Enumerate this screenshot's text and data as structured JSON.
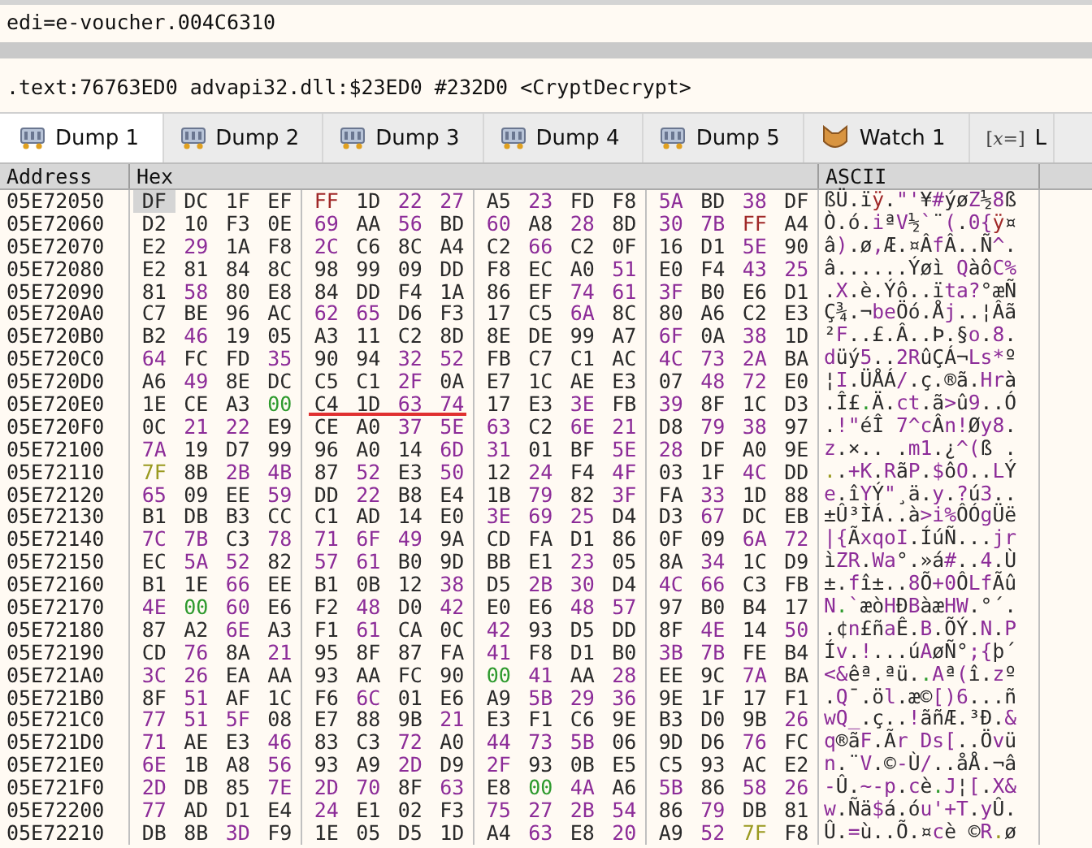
{
  "info": {
    "register_line": "edi=e-voucher.004C6310",
    "symbol_line": ".text:76763ED0 advapi32.dll:$23ED0 #232D0 <CryptDecrypt>"
  },
  "tabs": [
    {
      "label": "Dump 1",
      "kind": "dump",
      "selected": true
    },
    {
      "label": "Dump 2",
      "kind": "dump",
      "selected": false
    },
    {
      "label": "Dump 3",
      "kind": "dump",
      "selected": false
    },
    {
      "label": "Dump 4",
      "kind": "dump",
      "selected": false
    },
    {
      "label": "Dump 5",
      "kind": "dump",
      "selected": false
    },
    {
      "label": "Watch 1",
      "kind": "watch",
      "selected": false
    },
    {
      "label": "L",
      "kind": "locals",
      "glyph": "[*x=*]",
      "selected": false
    }
  ],
  "dump": {
    "columns": [
      "Address",
      "Hex",
      "ASCII"
    ],
    "rows": [
      {
        "address": "05E72050",
        "bytes": [
          "DF",
          "DC",
          "1F",
          "EF",
          "FF",
          "1D",
          "22",
          "27",
          "A5",
          "23",
          "FD",
          "F8",
          "5A",
          "BD",
          "38",
          "DF"
        ],
        "ascii": "ßÜ.ïÿ.\"'¥#ýøZ½8ß",
        "cursor": true,
        "underlined": false
      },
      {
        "address": "05E72060",
        "bytes": [
          "D2",
          "10",
          "F3",
          "0E",
          "69",
          "AA",
          "56",
          "BD",
          "60",
          "A8",
          "28",
          "8D",
          "30",
          "7B",
          "FF",
          "A4"
        ],
        "ascii": "Ò.ó.iªV½`¨(.0{ÿ¤",
        "cursor": false,
        "underlined": false
      },
      {
        "address": "05E72070",
        "bytes": [
          "E2",
          "29",
          "1A",
          "F8",
          "2C",
          "C6",
          "8C",
          "A4",
          "C2",
          "66",
          "C2",
          "0F",
          "16",
          "D1",
          "5E",
          "90"
        ],
        "ascii": "â).ø,Æ.¤ÂfÂ..Ñ^.",
        "cursor": false,
        "underlined": false
      },
      {
        "address": "05E72080",
        "bytes": [
          "E2",
          "81",
          "84",
          "8C",
          "98",
          "99",
          "09",
          "DD",
          "F8",
          "EC",
          "A0",
          "51",
          "E0",
          "F4",
          "43",
          "25"
        ],
        "ascii": "â......Ýøì QàôC%",
        "cursor": false,
        "underlined": false
      },
      {
        "address": "05E72090",
        "bytes": [
          "81",
          "58",
          "80",
          "E8",
          "84",
          "DD",
          "F4",
          "1A",
          "86",
          "EF",
          "74",
          "61",
          "3F",
          "B0",
          "E6",
          "D1"
        ],
        "ascii": ".X.è.Ýô..ïta?°æÑ",
        "cursor": false,
        "underlined": false
      },
      {
        "address": "05E720A0",
        "bytes": [
          "C7",
          "BE",
          "96",
          "AC",
          "62",
          "65",
          "D6",
          "F3",
          "17",
          "C5",
          "6A",
          "8C",
          "80",
          "A6",
          "C2",
          "E3"
        ],
        "ascii": "Ç¾.¬beÖó.Åj..¦Âã",
        "cursor": false,
        "underlined": false
      },
      {
        "address": "05E720B0",
        "bytes": [
          "B2",
          "46",
          "19",
          "05",
          "A3",
          "11",
          "C2",
          "8D",
          "8E",
          "DE",
          "99",
          "A7",
          "6F",
          "0A",
          "38",
          "1D"
        ],
        "ascii": "²F..£.Â..Þ.§o.8.",
        "cursor": false,
        "underlined": false
      },
      {
        "address": "05E720C0",
        "bytes": [
          "64",
          "FC",
          "FD",
          "35",
          "90",
          "94",
          "32",
          "52",
          "FB",
          "C7",
          "C1",
          "AC",
          "4C",
          "73",
          "2A",
          "BA"
        ],
        "ascii": "düý5..2RûÇÁ¬Ls*º",
        "cursor": false,
        "underlined": false
      },
      {
        "address": "05E720D0",
        "bytes": [
          "A6",
          "49",
          "8E",
          "DC",
          "C5",
          "C1",
          "2F",
          "0A",
          "E7",
          "1C",
          "AE",
          "E3",
          "07",
          "48",
          "72",
          "E0"
        ],
        "ascii": "¦I.ÜÅÁ/.ç.®ã.Hrà",
        "cursor": false,
        "underlined": false
      },
      {
        "address": "05E720E0",
        "bytes": [
          "1E",
          "CE",
          "A3",
          "00",
          "C4",
          "1D",
          "63",
          "74",
          "17",
          "E3",
          "3E",
          "FB",
          "39",
          "8F",
          "1C",
          "D3"
        ],
        "ascii": ".Î£.Ä.ct.ã>û9..Ó",
        "cursor": false,
        "underlined": true
      },
      {
        "address": "05E720F0",
        "bytes": [
          "0C",
          "21",
          "22",
          "E9",
          "CE",
          "A0",
          "37",
          "5E",
          "63",
          "C2",
          "6E",
          "21",
          "D8",
          "79",
          "38",
          "97"
        ],
        "ascii": ".!\"éÎ 7^cÂn!Øy8.",
        "cursor": false,
        "underlined": false
      },
      {
        "address": "05E72100",
        "bytes": [
          "7A",
          "19",
          "D7",
          "99",
          "96",
          "A0",
          "14",
          "6D",
          "31",
          "01",
          "BF",
          "5E",
          "28",
          "DF",
          "A0",
          "9E"
        ],
        "ascii": "z.×.. .m1.¿^(ß .",
        "cursor": false,
        "underlined": false
      },
      {
        "address": "05E72110",
        "bytes": [
          "7F",
          "8B",
          "2B",
          "4B",
          "87",
          "52",
          "E3",
          "50",
          "12",
          "24",
          "F4",
          "4F",
          "03",
          "1F",
          "4C",
          "DD"
        ],
        "ascii": "..+K.RãP.$ôO..LÝ",
        "cursor": false,
        "underlined": false
      },
      {
        "address": "05E72120",
        "bytes": [
          "65",
          "09",
          "EE",
          "59",
          "DD",
          "22",
          "B8",
          "E4",
          "1B",
          "79",
          "82",
          "3F",
          "FA",
          "33",
          "1D",
          "88"
        ],
        "ascii": "e.îYÝ\"¸ä.y.?ú3..",
        "cursor": false,
        "underlined": false
      },
      {
        "address": "05E72130",
        "bytes": [
          "B1",
          "DB",
          "B3",
          "CC",
          "C1",
          "AD",
          "14",
          "E0",
          "3E",
          "69",
          "25",
          "D4",
          "D3",
          "67",
          "DC",
          "EB"
        ],
        "ascii": "±Û³ÌÁ..à>i%ÔÓgÜë",
        "cursor": false,
        "underlined": false
      },
      {
        "address": "05E72140",
        "bytes": [
          "7C",
          "7B",
          "C3",
          "78",
          "71",
          "6F",
          "49",
          "9A",
          "CD",
          "FA",
          "D1",
          "86",
          "0F",
          "09",
          "6A",
          "72"
        ],
        "ascii": "|{ÃxqoI.ÍúÑ...jr",
        "cursor": false,
        "underlined": false
      },
      {
        "address": "05E72150",
        "bytes": [
          "EC",
          "5A",
          "52",
          "82",
          "57",
          "61",
          "B0",
          "9D",
          "BB",
          "E1",
          "23",
          "05",
          "8A",
          "34",
          "1C",
          "D9"
        ],
        "ascii": "ìZR.Wa°.»á#..4.Ù",
        "cursor": false,
        "underlined": false
      },
      {
        "address": "05E72160",
        "bytes": [
          "B1",
          "1E",
          "66",
          "EE",
          "B1",
          "0B",
          "12",
          "38",
          "D5",
          "2B",
          "30",
          "D4",
          "4C",
          "66",
          "C3",
          "FB"
        ],
        "ascii": "±.fî±..8Õ+0ÔLfÃû",
        "cursor": false,
        "underlined": false
      },
      {
        "address": "05E72170",
        "bytes": [
          "4E",
          "00",
          "60",
          "E6",
          "F2",
          "48",
          "D0",
          "42",
          "E0",
          "E6",
          "48",
          "57",
          "97",
          "B0",
          "B4",
          "17"
        ],
        "ascii": "N.`æòHÐBàæHW.°´.",
        "cursor": false,
        "underlined": false
      },
      {
        "address": "05E72180",
        "bytes": [
          "87",
          "A2",
          "6E",
          "A3",
          "F1",
          "61",
          "CA",
          "0C",
          "42",
          "93",
          "D5",
          "DD",
          "8F",
          "4E",
          "14",
          "50"
        ],
        "ascii": ".¢n£ñaÊ.B.ÕÝ.N.P",
        "cursor": false,
        "underlined": false
      },
      {
        "address": "05E72190",
        "bytes": [
          "CD",
          "76",
          "8A",
          "21",
          "95",
          "8F",
          "87",
          "FA",
          "41",
          "F8",
          "D1",
          "B0",
          "3B",
          "7B",
          "FE",
          "B4"
        ],
        "ascii": "Ív.!...úAøÑ°;{þ´",
        "cursor": false,
        "underlined": false
      },
      {
        "address": "05E721A0",
        "bytes": [
          "3C",
          "26",
          "EA",
          "AA",
          "93",
          "AA",
          "FC",
          "90",
          "00",
          "41",
          "AA",
          "28",
          "EE",
          "9C",
          "7A",
          "BA"
        ],
        "ascii": "<&êª.ªü..Aª(î.zº",
        "cursor": false,
        "underlined": false
      },
      {
        "address": "05E721B0",
        "bytes": [
          "8F",
          "51",
          "AF",
          "1C",
          "F6",
          "6C",
          "01",
          "E6",
          "A9",
          "5B",
          "29",
          "36",
          "9E",
          "1F",
          "17",
          "F1"
        ],
        "ascii": ".Q¯.öl.æ©[)6...ñ",
        "cursor": false,
        "underlined": false
      },
      {
        "address": "05E721C0",
        "bytes": [
          "77",
          "51",
          "5F",
          "08",
          "E7",
          "88",
          "9B",
          "21",
          "E3",
          "F1",
          "C6",
          "9E",
          "B3",
          "D0",
          "9B",
          "26"
        ],
        "ascii": "wQ_.ç..!ãñÆ.³Ð.&",
        "cursor": false,
        "underlined": false
      },
      {
        "address": "05E721D0",
        "bytes": [
          "71",
          "AE",
          "E3",
          "46",
          "83",
          "C3",
          "72",
          "A0",
          "44",
          "73",
          "5B",
          "06",
          "9D",
          "D6",
          "76",
          "FC"
        ],
        "ascii": "q®ãF.Ãr Ds[..Övü",
        "cursor": false,
        "underlined": false
      },
      {
        "address": "05E721E0",
        "bytes": [
          "6E",
          "1B",
          "A8",
          "56",
          "93",
          "A9",
          "2D",
          "D9",
          "2F",
          "93",
          "0B",
          "E5",
          "C5",
          "93",
          "AC",
          "E2"
        ],
        "ascii": "n.¨V.©-Ù/..åÅ.¬â",
        "cursor": false,
        "underlined": false
      },
      {
        "address": "05E721F0",
        "bytes": [
          "2D",
          "DB",
          "85",
          "7E",
          "2D",
          "70",
          "8F",
          "63",
          "E8",
          "00",
          "4A",
          "A6",
          "5B",
          "86",
          "58",
          "26"
        ],
        "ascii": "-Û.~-p.cè.J¦[.X&",
        "cursor": false,
        "underlined": false
      },
      {
        "address": "05E72200",
        "bytes": [
          "77",
          "AD",
          "D1",
          "E4",
          "24",
          "E1",
          "02",
          "F3",
          "75",
          "27",
          "2B",
          "54",
          "86",
          "79",
          "DB",
          "81"
        ],
        "ascii": "w.Ñä$á.óu'+T.yÛ.",
        "cursor": false,
        "underlined": false
      },
      {
        "address": "05E72210",
        "bytes": [
          "DB",
          "8B",
          "3D",
          "F9",
          "1E",
          "05",
          "D5",
          "1D",
          "A4",
          "63",
          "E8",
          "20",
          "A9",
          "52",
          "7F",
          "F8"
        ],
        "ascii": "Û.=ù..Õ.¤cè ©R.ø",
        "cursor": false,
        "underlined": false
      }
    ]
  }
}
